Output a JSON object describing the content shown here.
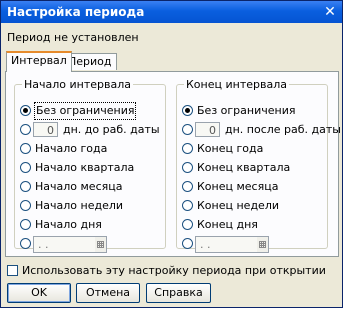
{
  "window": {
    "title": "Настройка периода",
    "close_label": "✕"
  },
  "status_text": "Период не установлен",
  "tabs": [
    {
      "label": "Интервал",
      "active": true
    },
    {
      "label": "Период",
      "active": false
    }
  ],
  "start_group": {
    "legend": "Начало интервала",
    "options": [
      {
        "label": "Без ограничения",
        "checked": true
      },
      {
        "days_value": "0",
        "label": "дн. до раб. даты",
        "checked": false
      },
      {
        "label": "Начало года",
        "checked": false
      },
      {
        "label": "Начало квартала",
        "checked": false
      },
      {
        "label": "Начало месяца",
        "checked": false
      },
      {
        "label": "Начало недели",
        "checked": false
      },
      {
        "label": "Начало дня",
        "checked": false
      },
      {
        "date_value": " .  .",
        "checked": false
      }
    ]
  },
  "end_group": {
    "legend": "Конец интервала",
    "options": [
      {
        "label": "Без ограничения",
        "checked": true
      },
      {
        "days_value": "0",
        "label": "дн. после раб. даты",
        "checked": false
      },
      {
        "label": "Конец года",
        "checked": false
      },
      {
        "label": "Конец квартала",
        "checked": false
      },
      {
        "label": "Конец месяца",
        "checked": false
      },
      {
        "label": "Конец недели",
        "checked": false
      },
      {
        "label": "Конец дня",
        "checked": false
      },
      {
        "date_value": " .  .",
        "checked": false
      }
    ]
  },
  "use_on_open": {
    "label": "Использовать эту настройку периода при открытии",
    "checked": false
  },
  "buttons": {
    "ok": "OK",
    "cancel": "Отмена",
    "help": "Справка"
  }
}
